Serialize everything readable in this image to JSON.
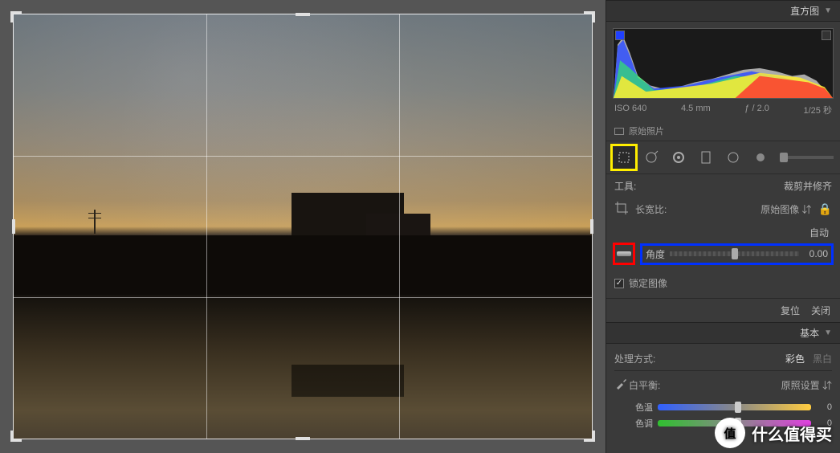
{
  "panels": {
    "histogram": {
      "title": "直方图"
    },
    "basic": {
      "title": "基本"
    }
  },
  "meta": {
    "iso": "ISO 640",
    "focal": "4.5 mm",
    "aperture": "ƒ / 2.0",
    "shutter": "1/25 秒"
  },
  "original": {
    "label": "原始照片"
  },
  "tool": {
    "label": "工具:",
    "current": "裁剪并修齐"
  },
  "aspect": {
    "label": "长宽比:",
    "value": "原始图像"
  },
  "angle": {
    "auto": "自动",
    "label": "角度",
    "value": "0.00"
  },
  "lockimg": {
    "label": "锁定图像"
  },
  "actions": {
    "reset": "复位",
    "close": "关闭"
  },
  "treatment": {
    "label": "处理方式:",
    "color": "彩色",
    "bw": "黑白"
  },
  "wb": {
    "label": "白平衡:",
    "value": "原照设置"
  },
  "sliders": {
    "temp": {
      "label": "色温",
      "value": "0",
      "pos": 50
    },
    "tint": {
      "label": "色调",
      "value": "0",
      "pos": 50
    }
  },
  "watermark": {
    "badge": "值",
    "text": "什么值得买"
  }
}
